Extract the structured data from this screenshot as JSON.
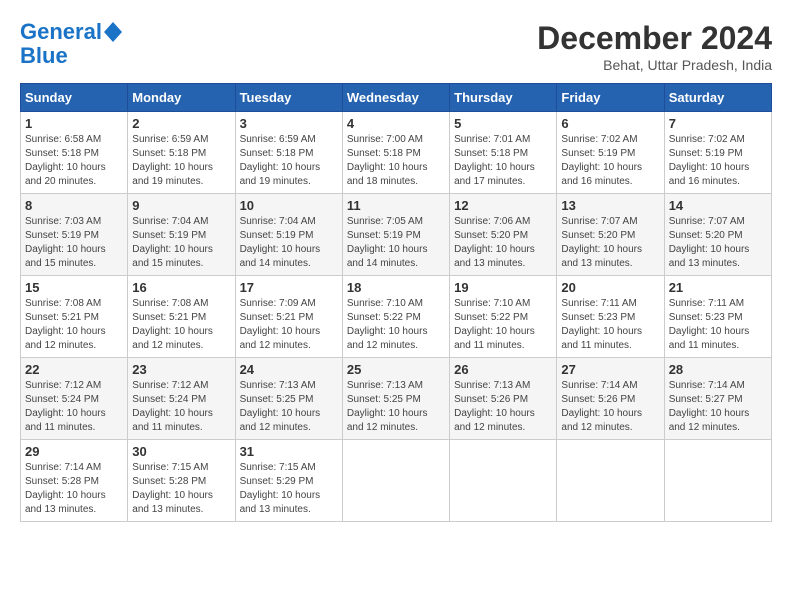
{
  "header": {
    "logo_line1": "General",
    "logo_line2": "Blue",
    "month": "December 2024",
    "location": "Behat, Uttar Pradesh, India"
  },
  "weekdays": [
    "Sunday",
    "Monday",
    "Tuesday",
    "Wednesday",
    "Thursday",
    "Friday",
    "Saturday"
  ],
  "weeks": [
    [
      {
        "day": "1",
        "info": "Sunrise: 6:58 AM\nSunset: 5:18 PM\nDaylight: 10 hours\nand 20 minutes."
      },
      {
        "day": "2",
        "info": "Sunrise: 6:59 AM\nSunset: 5:18 PM\nDaylight: 10 hours\nand 19 minutes."
      },
      {
        "day": "3",
        "info": "Sunrise: 6:59 AM\nSunset: 5:18 PM\nDaylight: 10 hours\nand 19 minutes."
      },
      {
        "day": "4",
        "info": "Sunrise: 7:00 AM\nSunset: 5:18 PM\nDaylight: 10 hours\nand 18 minutes."
      },
      {
        "day": "5",
        "info": "Sunrise: 7:01 AM\nSunset: 5:18 PM\nDaylight: 10 hours\nand 17 minutes."
      },
      {
        "day": "6",
        "info": "Sunrise: 7:02 AM\nSunset: 5:19 PM\nDaylight: 10 hours\nand 16 minutes."
      },
      {
        "day": "7",
        "info": "Sunrise: 7:02 AM\nSunset: 5:19 PM\nDaylight: 10 hours\nand 16 minutes."
      }
    ],
    [
      {
        "day": "8",
        "info": "Sunrise: 7:03 AM\nSunset: 5:19 PM\nDaylight: 10 hours\nand 15 minutes."
      },
      {
        "day": "9",
        "info": "Sunrise: 7:04 AM\nSunset: 5:19 PM\nDaylight: 10 hours\nand 15 minutes."
      },
      {
        "day": "10",
        "info": "Sunrise: 7:04 AM\nSunset: 5:19 PM\nDaylight: 10 hours\nand 14 minutes."
      },
      {
        "day": "11",
        "info": "Sunrise: 7:05 AM\nSunset: 5:19 PM\nDaylight: 10 hours\nand 14 minutes."
      },
      {
        "day": "12",
        "info": "Sunrise: 7:06 AM\nSunset: 5:20 PM\nDaylight: 10 hours\nand 13 minutes."
      },
      {
        "day": "13",
        "info": "Sunrise: 7:07 AM\nSunset: 5:20 PM\nDaylight: 10 hours\nand 13 minutes."
      },
      {
        "day": "14",
        "info": "Sunrise: 7:07 AM\nSunset: 5:20 PM\nDaylight: 10 hours\nand 13 minutes."
      }
    ],
    [
      {
        "day": "15",
        "info": "Sunrise: 7:08 AM\nSunset: 5:21 PM\nDaylight: 10 hours\nand 12 minutes."
      },
      {
        "day": "16",
        "info": "Sunrise: 7:08 AM\nSunset: 5:21 PM\nDaylight: 10 hours\nand 12 minutes."
      },
      {
        "day": "17",
        "info": "Sunrise: 7:09 AM\nSunset: 5:21 PM\nDaylight: 10 hours\nand 12 minutes."
      },
      {
        "day": "18",
        "info": "Sunrise: 7:10 AM\nSunset: 5:22 PM\nDaylight: 10 hours\nand 12 minutes."
      },
      {
        "day": "19",
        "info": "Sunrise: 7:10 AM\nSunset: 5:22 PM\nDaylight: 10 hours\nand 11 minutes."
      },
      {
        "day": "20",
        "info": "Sunrise: 7:11 AM\nSunset: 5:23 PM\nDaylight: 10 hours\nand 11 minutes."
      },
      {
        "day": "21",
        "info": "Sunrise: 7:11 AM\nSunset: 5:23 PM\nDaylight: 10 hours\nand 11 minutes."
      }
    ],
    [
      {
        "day": "22",
        "info": "Sunrise: 7:12 AM\nSunset: 5:24 PM\nDaylight: 10 hours\nand 11 minutes."
      },
      {
        "day": "23",
        "info": "Sunrise: 7:12 AM\nSunset: 5:24 PM\nDaylight: 10 hours\nand 11 minutes."
      },
      {
        "day": "24",
        "info": "Sunrise: 7:13 AM\nSunset: 5:25 PM\nDaylight: 10 hours\nand 12 minutes."
      },
      {
        "day": "25",
        "info": "Sunrise: 7:13 AM\nSunset: 5:25 PM\nDaylight: 10 hours\nand 12 minutes."
      },
      {
        "day": "26",
        "info": "Sunrise: 7:13 AM\nSunset: 5:26 PM\nDaylight: 10 hours\nand 12 minutes."
      },
      {
        "day": "27",
        "info": "Sunrise: 7:14 AM\nSunset: 5:26 PM\nDaylight: 10 hours\nand 12 minutes."
      },
      {
        "day": "28",
        "info": "Sunrise: 7:14 AM\nSunset: 5:27 PM\nDaylight: 10 hours\nand 12 minutes."
      }
    ],
    [
      {
        "day": "29",
        "info": "Sunrise: 7:14 AM\nSunset: 5:28 PM\nDaylight: 10 hours\nand 13 minutes."
      },
      {
        "day": "30",
        "info": "Sunrise: 7:15 AM\nSunset: 5:28 PM\nDaylight: 10 hours\nand 13 minutes."
      },
      {
        "day": "31",
        "info": "Sunrise: 7:15 AM\nSunset: 5:29 PM\nDaylight: 10 hours\nand 13 minutes."
      },
      {
        "day": "",
        "info": ""
      },
      {
        "day": "",
        "info": ""
      },
      {
        "day": "",
        "info": ""
      },
      {
        "day": "",
        "info": ""
      }
    ]
  ]
}
